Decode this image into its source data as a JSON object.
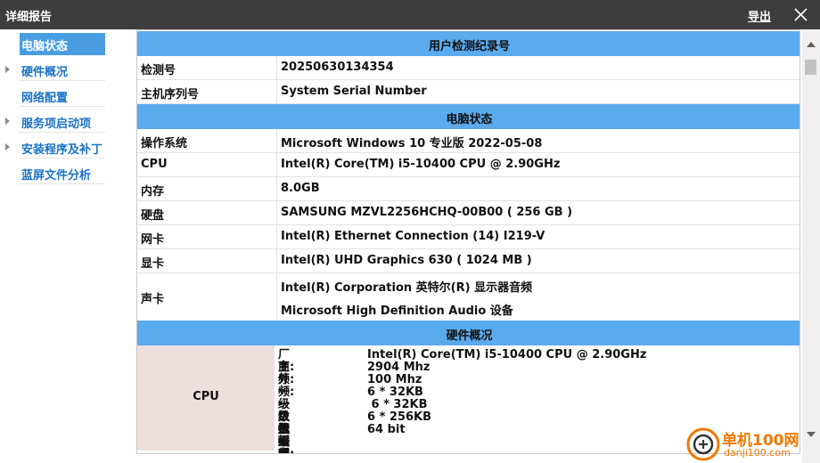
{
  "window": {
    "title": "详细报告",
    "export_label": "导出"
  },
  "sidebar": {
    "items": [
      {
        "label": "电脑状态",
        "active": true,
        "expandable": false
      },
      {
        "label": "硬件概况",
        "active": false,
        "expandable": true
      },
      {
        "label": "网络配置",
        "active": false,
        "expandable": false
      },
      {
        "label": "服务项启动项",
        "active": false,
        "expandable": true
      },
      {
        "label": "安装程序及补丁",
        "active": false,
        "expandable": true
      },
      {
        "label": "蓝屏文件分析",
        "active": false,
        "expandable": false
      }
    ]
  },
  "report": {
    "section1": {
      "title": "用户检测纪录号",
      "rows": [
        {
          "key": "检测号",
          "value": "20250630134354"
        },
        {
          "key": "主机序列号",
          "value": "System Serial Number"
        }
      ]
    },
    "section2": {
      "title": "电脑状态",
      "rows": [
        {
          "key": "操作系统",
          "value": "Microsoft Windows 10 专业版 2022-05-08"
        },
        {
          "key": "CPU",
          "value": "Intel(R) Core(TM) i5-10400 CPU @ 2.90GHz"
        },
        {
          "key": "内存",
          "value": "8.0GB"
        },
        {
          "key": "硬盘",
          "value": "SAMSUNG MZVL2256HCHQ-00B00 ( 256 GB )"
        },
        {
          "key": "网卡",
          "value": "Intel(R) Ethernet Connection (14) I219-V"
        },
        {
          "key": "显卡",
          "value": "Intel(R) UHD Graphics 630 ( 1024 MB )"
        }
      ],
      "sound": {
        "key": "声卡",
        "values": [
          "Intel(R) Corporation 英特尔(R) 显示器音频",
          "Microsoft High Definition Audio 设备"
        ]
      }
    },
    "section3": {
      "title": "硬件概况",
      "cpu": {
        "key": "CPU",
        "details": [
          {
            "label": "厂商:",
            "value": "Intel(R) Core(TM) i5-10400 CPU @ 2.90GHz"
          },
          {
            "label": "主频:",
            "value": "2904 Mhz"
          },
          {
            "label": "外频:",
            "value": "100 Mhz"
          },
          {
            "label": "一级数据缓存:",
            "value": "6 * 32KB"
          },
          {
            "label": "一级代码缓存:",
            "value": " 6 * 32KB"
          },
          {
            "label": "二级缓存:",
            "value": "6 * 256KB"
          },
          {
            "label": "数据宽度:",
            "value": "64 bit"
          }
        ]
      }
    }
  },
  "watermark": {
    "name": "单机100网",
    "url": "danji100.com"
  },
  "icons": {
    "close": "close-icon",
    "expand": "triangle-right-icon",
    "scroll_up": "scroll-up-arrow-icon",
    "scroll_down": "scroll-down-arrow-icon",
    "watermark_logo": "danji100-logo"
  },
  "colors": {
    "titlebar": "#3d3d3d",
    "section_header": "#5aaaee",
    "nav_active_bg": "#4a9de0",
    "nav_link": "#1a73c8",
    "cpu_key_bg": "#efdede",
    "watermark": "#f07800"
  }
}
